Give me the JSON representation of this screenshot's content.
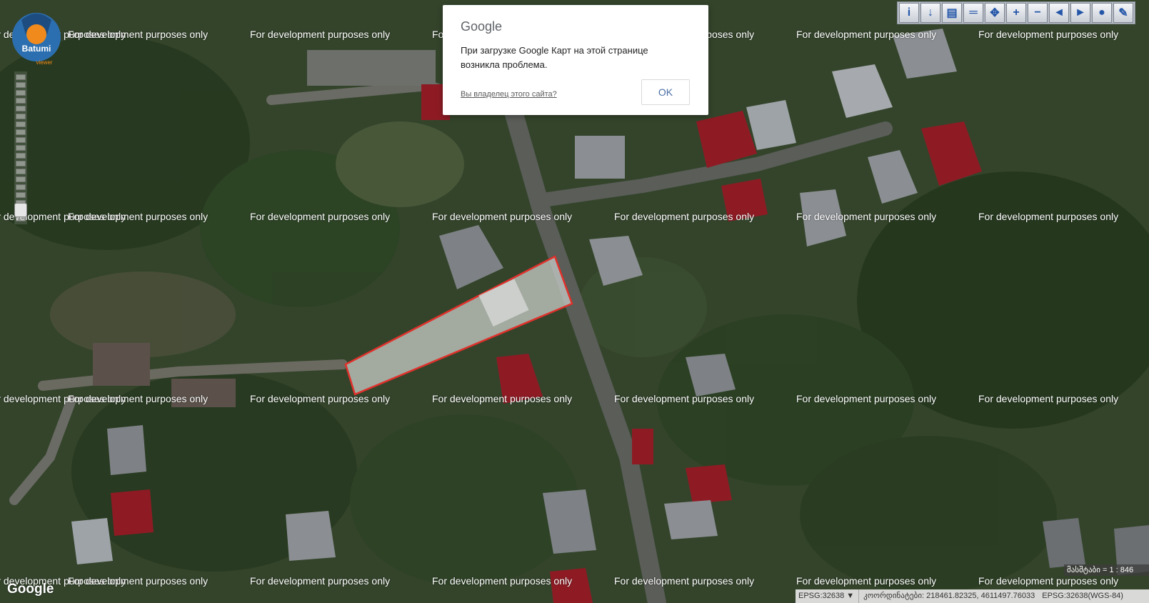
{
  "watermark": "For development purposes only",
  "dialog": {
    "brand": "Google",
    "message": "При загрузке Google Карт на этой странице возникла проблема.",
    "owner_link": "Вы владелец этого сайта?",
    "ok_label": "OK"
  },
  "logo": {
    "text": "Batumi",
    "subtext": "viewer"
  },
  "toolbar": {
    "tools": [
      {
        "icon": "info-icon",
        "glyph": "i"
      },
      {
        "icon": "download-icon",
        "glyph": "↓"
      },
      {
        "icon": "area-measure-icon",
        "glyph": "▤"
      },
      {
        "icon": "ruler-icon",
        "glyph": "═"
      },
      {
        "icon": "pan-icon",
        "glyph": "✥"
      },
      {
        "icon": "zoom-in-icon",
        "glyph": "+"
      },
      {
        "icon": "zoom-out-icon",
        "glyph": "−"
      },
      {
        "icon": "zoom-previous-icon",
        "glyph": "◄"
      },
      {
        "icon": "zoom-next-icon",
        "glyph": "►"
      },
      {
        "icon": "globe-icon",
        "glyph": "●"
      },
      {
        "icon": "pencil-icon",
        "glyph": "✎"
      }
    ]
  },
  "zoom": {
    "level": 0.95
  },
  "scale": "მასშტაბი = 1 : 846",
  "status": {
    "epsg_select": "EPSG:32638 ▼",
    "coordinates": "კოორდინატები: 218461.82325, 4611497.76033",
    "epsg_right": "EPSG:32638(WGS-84)"
  },
  "google_logo": "Google",
  "colors": {
    "parcel_outline": "#e0312b",
    "parcel_fill": "#c8ccc8",
    "roof_red": "#8e1b24",
    "roof_gray": "#8b8f93",
    "vegetation": "#2f4424"
  }
}
